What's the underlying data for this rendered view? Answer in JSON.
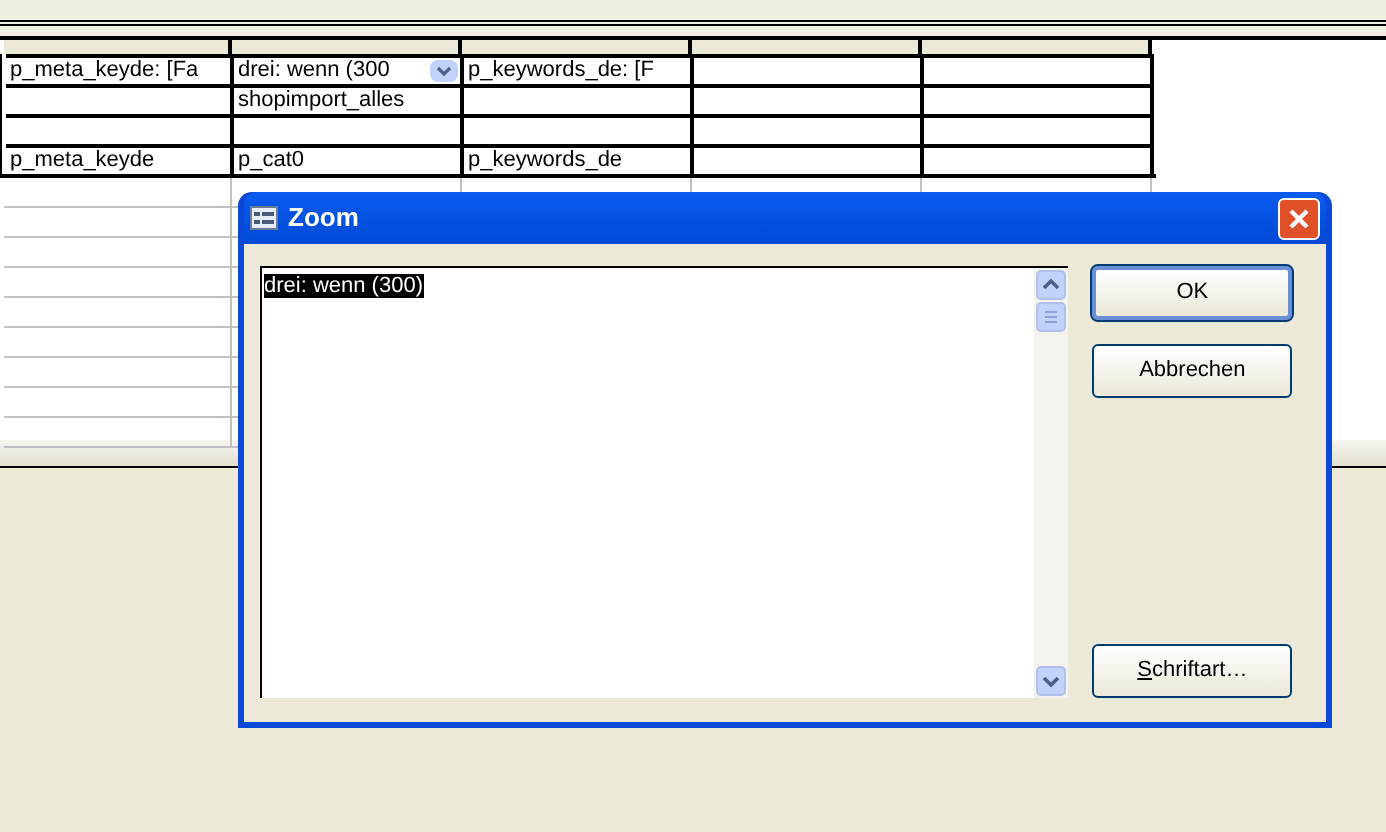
{
  "grid": {
    "rows": [
      [
        {
          "kind": "text",
          "text": "p_meta_keyde: [Fa"
        },
        {
          "kind": "combo",
          "text": "drei: wenn (300"
        },
        {
          "kind": "text",
          "text": "p_keywords_de: [F"
        },
        {
          "kind": "empty"
        },
        {
          "kind": "empty"
        }
      ],
      [
        {
          "kind": "empty"
        },
        {
          "kind": "text",
          "text": "shopimport_alles"
        },
        {
          "kind": "empty"
        },
        {
          "kind": "empty"
        },
        {
          "kind": "empty"
        }
      ],
      [
        {
          "kind": "empty"
        },
        {
          "kind": "empty"
        },
        {
          "kind": "empty"
        },
        {
          "kind": "empty"
        },
        {
          "kind": "empty"
        }
      ],
      [
        {
          "kind": "text",
          "text": "p_meta_keyde"
        },
        {
          "kind": "text",
          "text": "p_cat0"
        },
        {
          "kind": "text",
          "text": "p_keywords_de"
        },
        {
          "kind": "empty"
        },
        {
          "kind": "empty"
        }
      ]
    ]
  },
  "dialog": {
    "title": "Zoom",
    "text": "drei: wenn (300)",
    "buttons": [
      {
        "label": "OK",
        "default": true
      },
      {
        "label": "Abbrechen",
        "default": false
      },
      {
        "label": "Schriftart…",
        "default": false,
        "first_letter_underlined": true
      }
    ]
  }
}
